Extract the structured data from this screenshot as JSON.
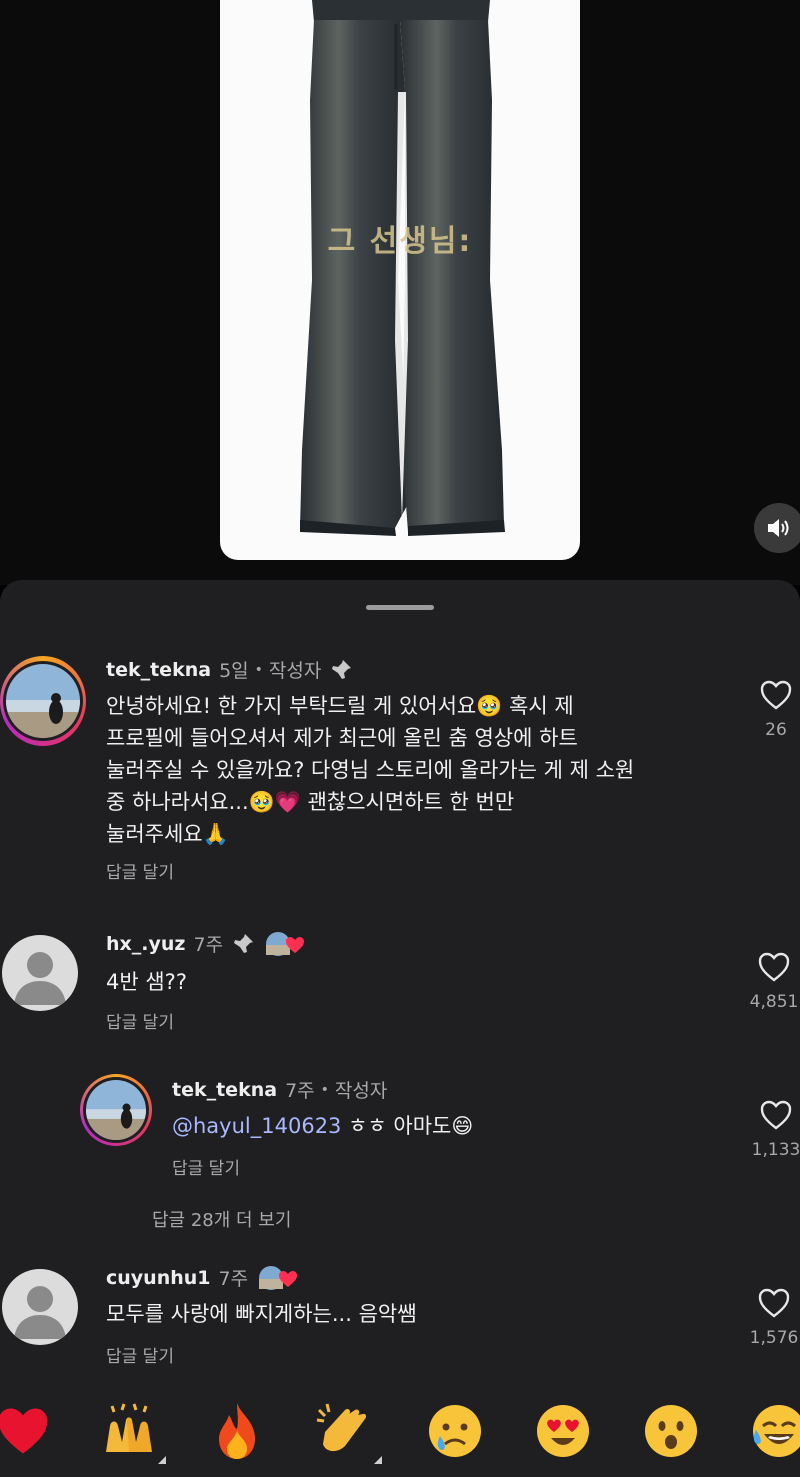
{
  "reel": {
    "overlay_text": "그 선생님:"
  },
  "comments": [
    {
      "username": "tek_tekna",
      "time": "5일",
      "separator": "•",
      "author_badge": "작성자",
      "text_lines": [
        "안녕하세요! 한 가지 부탁드릴 게 있어서요🥹 혹시 제",
        "프로필에 들어오셔서 제가 최근에 올린 춤 영상에 하트",
        "눌러주실 수 있을까요? 다영님 스토리에 올라가는 게 제 소원",
        "중 하나라서요...🥹💗 괜찮으시면하트 한 번만",
        "눌러주세요🙏"
      ],
      "reply_label": "답글 달기",
      "likes": "26"
    },
    {
      "username": "hx_.yuz",
      "time": "7주",
      "text": "4반 샘??",
      "reply_label": "답글 달기",
      "likes": "4,851"
    },
    {
      "username": "tek_tekna",
      "time": "7주",
      "separator": "•",
      "author_badge": "작성자",
      "mention": "@hayul_140623",
      "text": " ㅎㅎ 아마도😄",
      "reply_label": "답글 달기",
      "likes": "1,133"
    },
    {
      "view_more": "답글 28개 더 보기"
    },
    {
      "username": "cuyunhu1",
      "time": "7주",
      "text": "모두를 사랑에 빠지게하는... 음악쌤",
      "reply_label": "답글 달기",
      "likes": "1,576"
    }
  ],
  "emoji_bar": [
    "❤️",
    "🙌",
    "🔥",
    "👏",
    "😢",
    "😍",
    "😮",
    "😂"
  ],
  "icons": {
    "sound": "speaker-icon",
    "pin": "pin-icon",
    "like": "heart-outline-icon",
    "liked_by_creator": "creator-heart-avatar-icon"
  }
}
